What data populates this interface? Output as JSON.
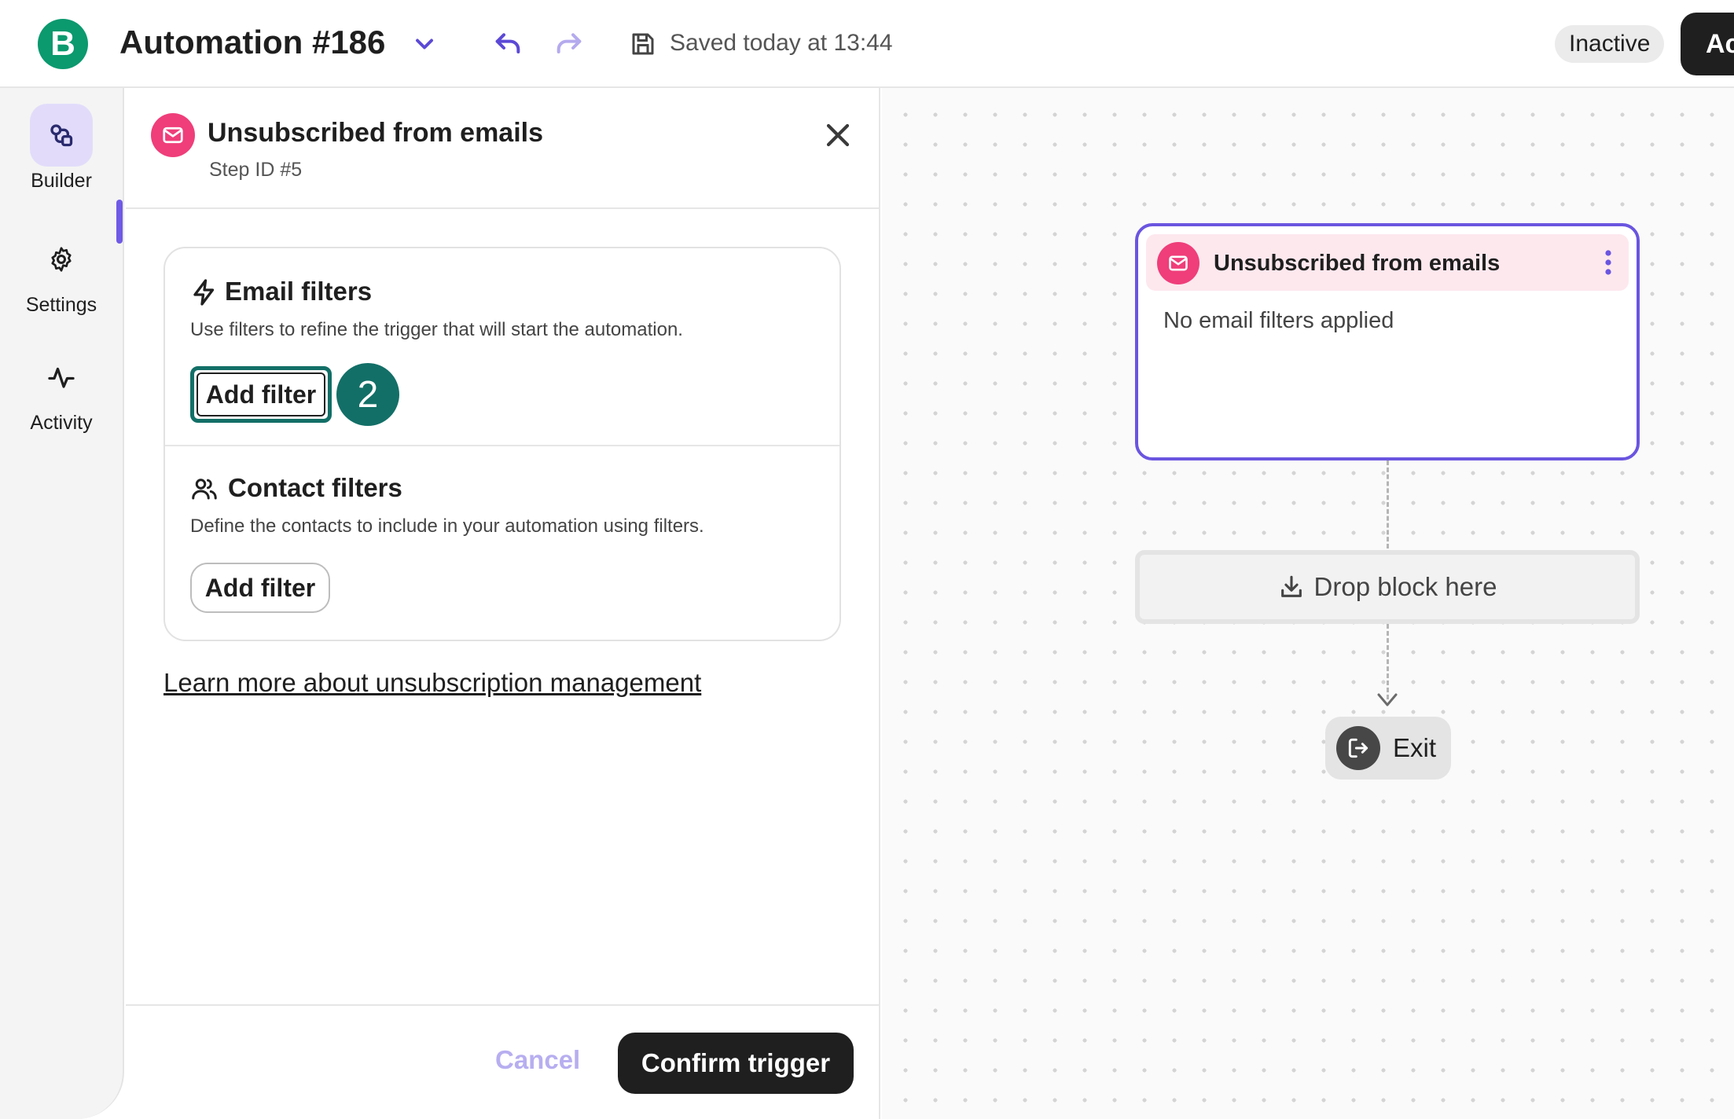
{
  "header": {
    "logo_letter": "B",
    "title": "Automation #186",
    "saved_status": "Saved today at 13:44",
    "status_badge": "Inactive",
    "activate_label": "Ac"
  },
  "nav": {
    "items": [
      {
        "label": "Builder",
        "icon": "builder-icon",
        "active": true
      },
      {
        "label": "Settings",
        "icon": "gear-icon",
        "active": false
      },
      {
        "label": "Activity",
        "icon": "activity-icon",
        "active": false
      }
    ]
  },
  "panel": {
    "title": "Unsubscribed from emails",
    "step_id": "Step ID #5",
    "email_filters": {
      "title": "Email filters",
      "description": "Use filters to refine the trigger that will start the automation.",
      "button": "Add filter",
      "step_marker": "2"
    },
    "contact_filters": {
      "title": "Contact filters",
      "description": "Define the contacts to include in your automation using filters.",
      "button": "Add filter"
    },
    "learn_more": "Learn more about unsubscription management",
    "cancel": "Cancel",
    "confirm": "Confirm trigger"
  },
  "canvas": {
    "trigger_card": {
      "title": "Unsubscribed from emails",
      "body": "No email filters applied"
    },
    "drop_block": "Drop block here",
    "exit": "Exit"
  },
  "colors": {
    "brand_green": "#0b996e",
    "accent_purple": "#6a55e0",
    "trigger_pink": "#ef3e7a",
    "focus_teal": "#126f67"
  }
}
